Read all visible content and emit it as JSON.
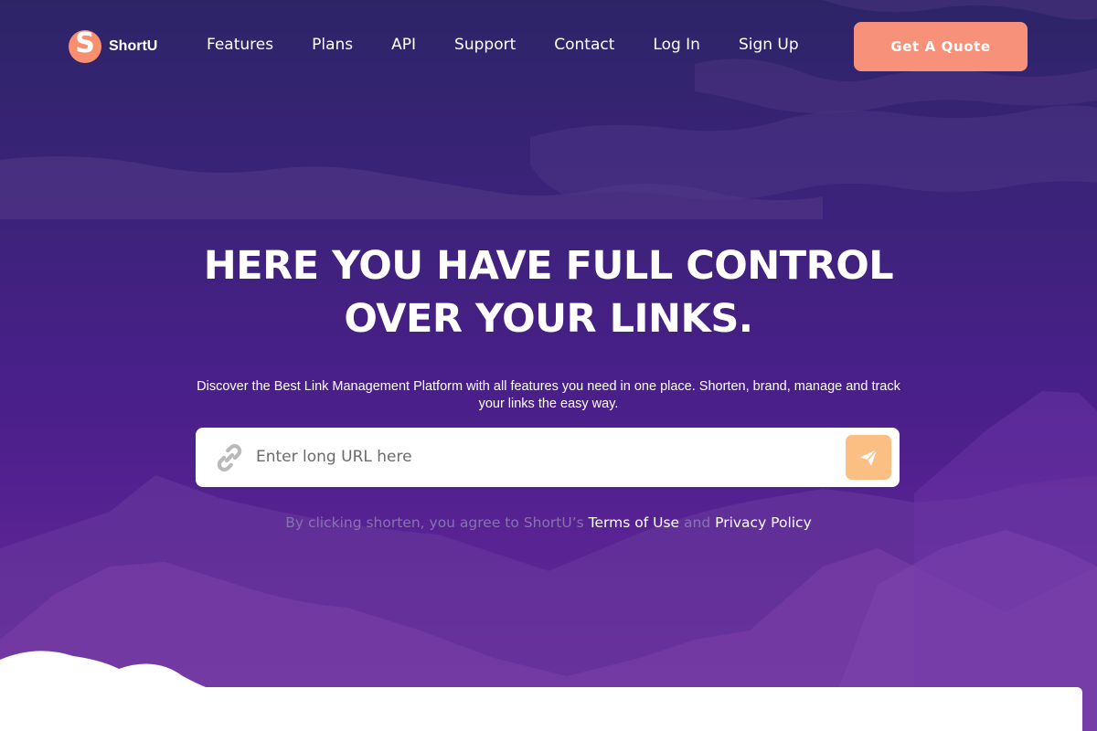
{
  "brand": {
    "name": "ShortU",
    "logo_letter": "S",
    "accent": "#f98f6f"
  },
  "nav": {
    "items": [
      {
        "label": "Features"
      },
      {
        "label": "Plans"
      },
      {
        "label": "API"
      },
      {
        "label": "Support"
      },
      {
        "label": "Contact"
      },
      {
        "label": "Log In"
      },
      {
        "label": "Sign Up"
      }
    ],
    "cta_label": "Get A Quote",
    "cta_color": "#f8917a"
  },
  "hero": {
    "title_line1": "HERE YOU HAVE FULL CONTROL",
    "title_line2": "OVER YOUR LINKS.",
    "subtitle": "Discover the Best Link Management Platform with all features you need in one place. Shorten, brand, manage and track your links the easy way.",
    "input_placeholder": "Enter long URL here",
    "input_icon": "link-icon",
    "submit_icon": "paper-plane-icon",
    "submit_color": "#fbbf84"
  },
  "terms": {
    "prefix": "By clicking shorten, you agree to ShortU’s",
    "terms_link": "Terms of Use",
    "and": "and",
    "privacy_link": "Privacy Policy"
  }
}
